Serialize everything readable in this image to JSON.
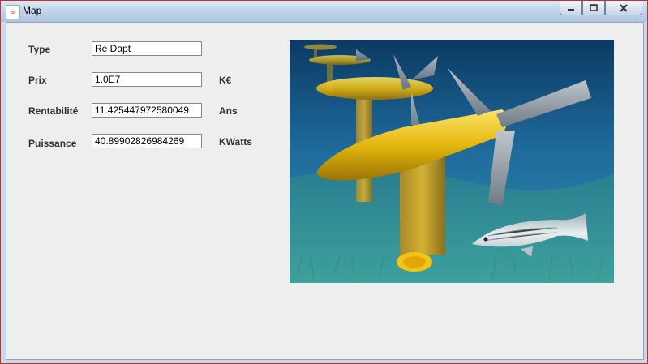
{
  "window": {
    "title": "Map",
    "app_icon": "java-icon",
    "caption_buttons": [
      "minimize-icon",
      "maximize-icon",
      "close-icon"
    ]
  },
  "form": {
    "rows": [
      {
        "label": "Type",
        "value": "Re Dapt",
        "unit": ""
      },
      {
        "label": "Prix",
        "value": "1.0E7",
        "unit": "K€"
      },
      {
        "label": "Rentabilité",
        "value": "11.425447972580049",
        "unit": "Ans"
      },
      {
        "label": "Puissance",
        "value": "40.89902826984269",
        "unit": "KWatts"
      }
    ]
  },
  "colors": {
    "accent_yellow": "#f2c40f",
    "water_blue": "#1f6a9c",
    "client_bg": "#eeeeee"
  }
}
